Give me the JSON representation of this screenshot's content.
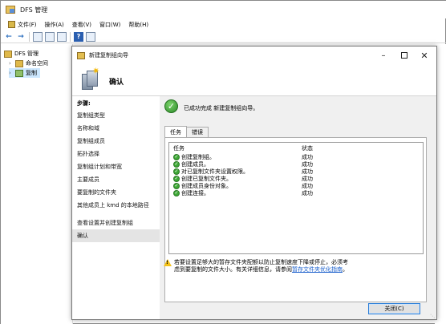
{
  "mmc": {
    "title": "DFS 管理",
    "menu": [
      "文件(F)",
      "操作(A)",
      "查看(V)",
      "窗口(W)",
      "帮助(H)"
    ],
    "tree": {
      "root": "DFS 管理",
      "namespace": "命名空间",
      "replication": "复制"
    }
  },
  "wizard": {
    "title": "新建复制组向导",
    "header_title": "确认",
    "steps_label": "步骤:",
    "steps": [
      "复制组类型",
      "名称和域",
      "复制组成员",
      "拓扑选择",
      "复制组计划和带宽",
      "主要成员",
      "要复制的文件夹",
      "其他成员上 kmd 的本地路径",
      "查看设置并创建复制组",
      "确认"
    ],
    "active_step_index": 9,
    "success_message": "已成功完成 新建复制组向导。",
    "tabs": [
      "任务",
      "错误"
    ],
    "active_tab": "任务",
    "columns": {
      "task": "任务",
      "status": "状态"
    },
    "rows": [
      {
        "task": "创建复制组。",
        "status": "成功"
      },
      {
        "task": "创建成员。",
        "status": "成功"
      },
      {
        "task": "对已复制文件夹设置权限。",
        "status": "成功"
      },
      {
        "task": "创建已复制文件夹。",
        "status": "成功"
      },
      {
        "task": "创建成员身份对象。",
        "status": "成功"
      },
      {
        "task": "创建连接。",
        "status": "成功"
      }
    ],
    "warning_text": "若要设置足够大的暂存文件夹配额以防止复制速度下降或停止，必须考虑到要复制的文件大小。有关详细信息，请参阅",
    "warning_link": "暂存文件夹优化指南",
    "warning_end": "。",
    "close_label": "关闭(C)"
  },
  "colors": {
    "accent": "#2b7ed8",
    "success": "#3ea836",
    "warning": "#f4c21a",
    "link": "#1a5fcc"
  }
}
